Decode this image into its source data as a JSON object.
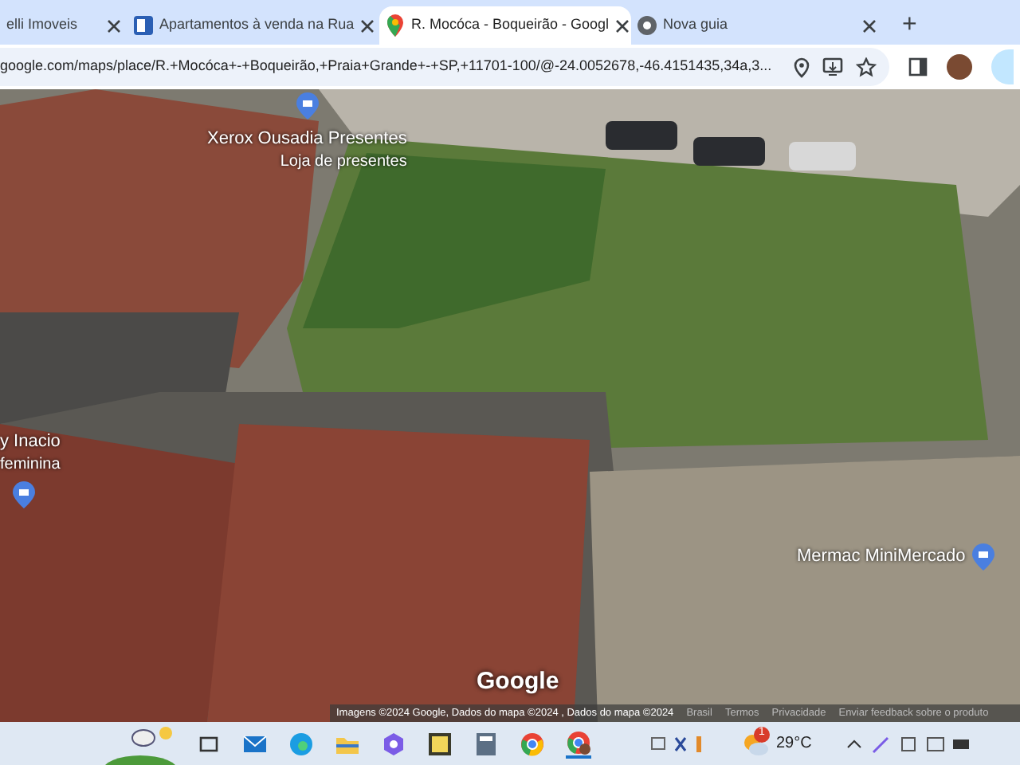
{
  "tabs": [
    {
      "title": "elli Imoveis",
      "selected": false
    },
    {
      "title": "Apartamentos à venda na Rua",
      "selected": false
    },
    {
      "title": "R. Mocóca - Boqueirão - Googl",
      "selected": true
    },
    {
      "title": "Nova guia",
      "selected": false
    }
  ],
  "new_tab": "+",
  "address_bar": {
    "url": "google.com/maps/place/R.+Mocóca+-+Boqueirão,+Praia+Grande+-+SP,+11701-100/@-24.0052678,-46.4151435,34a,3..."
  },
  "map": {
    "places": [
      {
        "name": "Xerox Ousadia Presentes",
        "category": "Loja de presentes"
      },
      {
        "name": "y Inacio",
        "category": "feminina"
      },
      {
        "name": "Mermac MiniMercado"
      }
    ],
    "logo": "Google",
    "attribution": "Imagens ©2024 Google, Dados do mapa ©2024 , Dados do mapa ©2024",
    "footer_links": [
      "Brasil",
      "Termos",
      "Privacidade",
      "Enviar feedback sobre o produto"
    ]
  },
  "taskbar": {
    "weather": {
      "temperature": "29°C",
      "badge": "1"
    }
  }
}
